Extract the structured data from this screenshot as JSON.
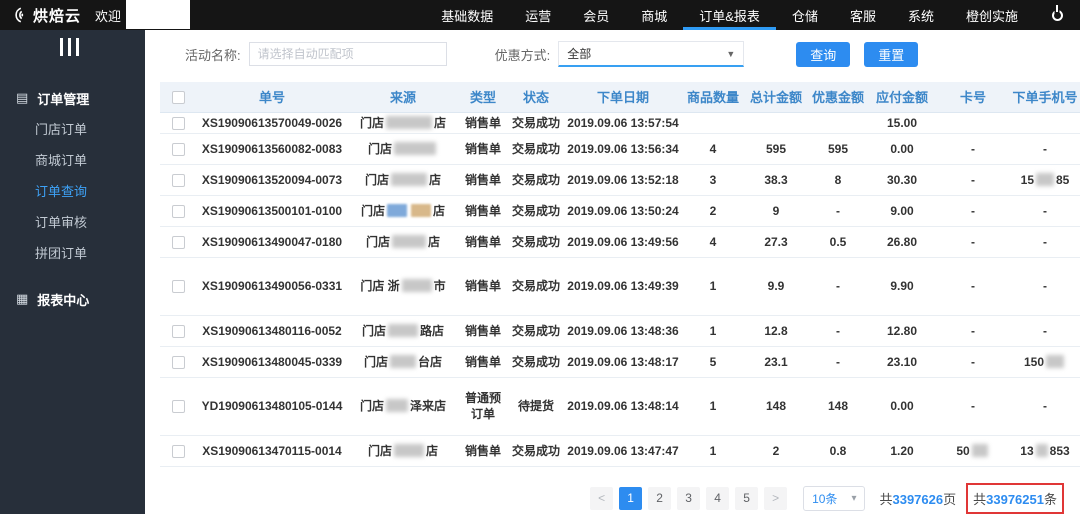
{
  "topbar": {
    "brand": "烘焙云",
    "welcome": "欢迎",
    "nav": [
      {
        "label": "基础数据",
        "active": false
      },
      {
        "label": "运营",
        "active": false
      },
      {
        "label": "会员",
        "active": false
      },
      {
        "label": "商城",
        "active": false
      },
      {
        "label": "订单&报表",
        "active": true
      },
      {
        "label": "仓储",
        "active": false
      },
      {
        "label": "客服",
        "active": false
      },
      {
        "label": "系统",
        "active": false
      },
      {
        "label": "橙创实施",
        "active": false
      }
    ]
  },
  "sidebar": {
    "sections": [
      {
        "label": "订单管理",
        "icon": "orders-icon",
        "items": [
          {
            "label": "门店订单",
            "active": false
          },
          {
            "label": "商城订单",
            "active": false
          },
          {
            "label": "订单查询",
            "active": true
          },
          {
            "label": "订单审核",
            "active": false
          },
          {
            "label": "拼团订单",
            "active": false
          }
        ]
      },
      {
        "label": "报表中心",
        "icon": "report-icon",
        "items": []
      }
    ]
  },
  "filters": {
    "activity_label": "活动名称:",
    "activity_placeholder": "请选择自动匹配项",
    "discount_label": "优惠方式:",
    "discount_value": "全部",
    "search_button": "查询",
    "reset_button": "重置"
  },
  "table": {
    "headers": [
      "单号",
      "来源",
      "类型",
      "状态",
      "下单日期",
      "商品数量",
      "总计金额",
      "优惠金额",
      "应付金额",
      "卡号",
      "下单手机号"
    ],
    "rows": [
      {
        "clipped": true,
        "order_no": "XS19090613570049-0026",
        "source": {
          "pre": "门店",
          "blur": 46,
          "post": "店"
        },
        "type": "销售单",
        "status": "交易成功",
        "date": "2019.09.06 13:57:54",
        "qty": "",
        "total": "",
        "discount": "",
        "payable": "15.00",
        "card": "",
        "phone": ""
      },
      {
        "order_no": "XS19090613560082-0083",
        "source": {
          "pre": "门店",
          "blur": 42,
          "post": ""
        },
        "type": "销售单",
        "status": "交易成功",
        "date": "2019.09.06 13:56:34",
        "qty": "4",
        "total": "595",
        "discount": "595",
        "payable": "0.00",
        "card": "-",
        "phone": "-"
      },
      {
        "order_no": "XS19090613520094-0073",
        "source": {
          "pre": "门店",
          "blur": 36,
          "post": "店"
        },
        "type": "销售单",
        "status": "交易成功",
        "date": "2019.09.06 13:52:18",
        "qty": "3",
        "total": "38.3",
        "discount": "8",
        "payable": "30.30",
        "card": "-",
        "phone": {
          "pre": "15",
          "blur": 18,
          "post": "85"
        }
      },
      {
        "order_no": "XS19090613500101-0100",
        "source": {
          "pre": "门店",
          "colors": [
            "#7fa9da",
            "#d8b88a"
          ],
          "post": "店"
        },
        "type": "销售单",
        "status": "交易成功",
        "date": "2019.09.06 13:50:24",
        "qty": "2",
        "total": "9",
        "discount": "-",
        "payable": "9.00",
        "card": "-",
        "phone": "-"
      },
      {
        "order_no": "XS19090613490047-0180",
        "source": {
          "pre": "门店",
          "blur": 34,
          "post": "店"
        },
        "type": "销售单",
        "status": "交易成功",
        "date": "2019.09.06 13:49:56",
        "qty": "4",
        "total": "27.3",
        "discount": "0.5",
        "payable": "26.80",
        "card": "-",
        "phone": "-"
      },
      {
        "tall": true,
        "order_no": "XS19090613490056-0331",
        "source": {
          "pre": "门店 浙",
          "blur": 30,
          "post": "市"
        },
        "type": "销售单",
        "status": "交易成功",
        "date": "2019.09.06 13:49:39",
        "qty": "1",
        "total": "9.9",
        "discount": "-",
        "payable": "9.90",
        "card": "-",
        "phone": "-"
      },
      {
        "order_no": "XS19090613480116-0052",
        "source": {
          "pre": "门店",
          "blur": 30,
          "post": "路店"
        },
        "type": "销售单",
        "status": "交易成功",
        "date": "2019.09.06 13:48:36",
        "qty": "1",
        "total": "12.8",
        "discount": "-",
        "payable": "12.80",
        "card": "-",
        "phone": "-"
      },
      {
        "order_no": "XS19090613480045-0339",
        "source": {
          "pre": "门店",
          "blur": 26,
          "post": "台店"
        },
        "type": "销售单",
        "status": "交易成功",
        "date": "2019.09.06 13:48:17",
        "qty": "5",
        "total": "23.1",
        "discount": "-",
        "payable": "23.10",
        "card": "-",
        "phone": {
          "pre": "150",
          "blur": 18,
          "post": ""
        }
      },
      {
        "tall": true,
        "order_no": "YD19090613480105-0144",
        "source": {
          "pre": "门店",
          "blur": 22,
          "post": "泽来店"
        },
        "type": "普通预订单",
        "status": "待提货",
        "date": "2019.09.06 13:48:14",
        "qty": "1",
        "total": "148",
        "discount": "148",
        "payable": "0.00",
        "card": "-",
        "phone": "-"
      },
      {
        "order_no": "XS19090613470115-0014",
        "source": {
          "pre": "门店",
          "blur": 30,
          "post": "店"
        },
        "type": "销售单",
        "status": "交易成功",
        "date": "2019.09.06 13:47:47",
        "qty": "1",
        "total": "2",
        "discount": "0.8",
        "payable": "1.20",
        "card": {
          "pre": "50",
          "blur": 16,
          "post": ""
        },
        "phone": {
          "pre": "13",
          "blur": 12,
          "post": "853"
        }
      }
    ]
  },
  "pagination": {
    "prev": "<",
    "next": ">",
    "pages": [
      "1",
      "2",
      "3",
      "4",
      "5"
    ],
    "active": "1",
    "size_label": "10条",
    "totals_prefix": "共",
    "pages_total": "3397626",
    "pages_suffix": "页",
    "items_total": "33976251",
    "items_suffix": "条"
  },
  "colors": {
    "accent": "#2d8cf0",
    "danger": "#e03636"
  }
}
